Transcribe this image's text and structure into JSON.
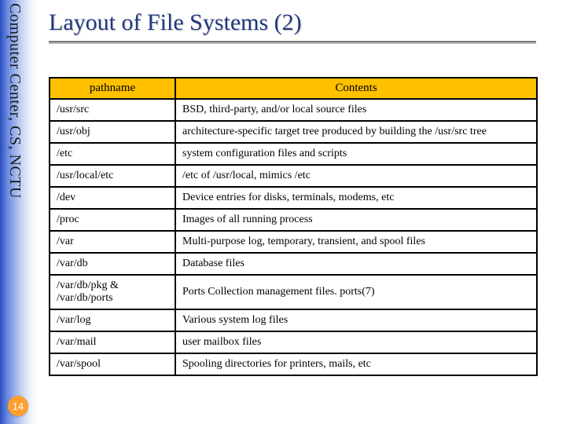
{
  "sidebar": {
    "label": "Computer Center, CS, NCTU"
  },
  "page_number": "14",
  "title": "Layout of File Systems (2)",
  "table": {
    "headers": {
      "pathname": "pathname",
      "contents": "Contents"
    },
    "rows": [
      {
        "path": "/usr/src",
        "desc": "BSD, third-party, and/or local source files"
      },
      {
        "path": "/usr/obj",
        "desc": "architecture-specific target tree produced by building the /usr/src tree"
      },
      {
        "path": "/etc",
        "desc": "system configuration files and scripts"
      },
      {
        "path": "/usr/local/etc",
        "desc": "/etc of /usr/local, mimics /etc"
      },
      {
        "path": "/dev",
        "desc": "Device entries for disks, terminals, modems, etc"
      },
      {
        "path": "/proc",
        "desc": "Images of all running process"
      },
      {
        "path": "/var",
        "desc": "Multi-purpose log, temporary, transient, and spool files"
      },
      {
        "path": "/var/db",
        "desc": "Database files"
      },
      {
        "path": "/var/db/pkg & /var/db/ports",
        "desc": "Ports Collection management files. ports(7)"
      },
      {
        "path": "/var/log",
        "desc": "Various system log files"
      },
      {
        "path": "/var/mail",
        "desc": "user mailbox files"
      },
      {
        "path": "/var/spool",
        "desc": "Spooling directories for printers, mails, etc"
      }
    ]
  }
}
